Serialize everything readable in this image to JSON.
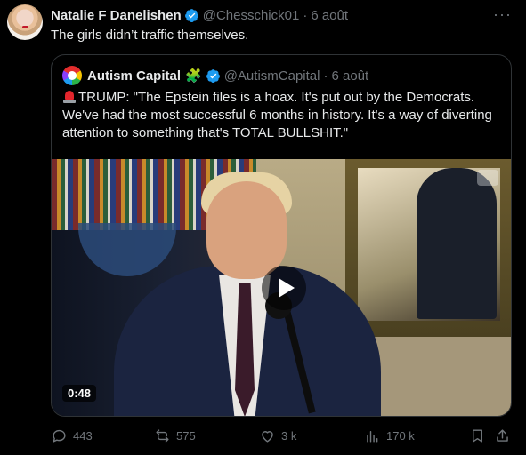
{
  "post": {
    "author_name": "Natalie F Danelishen",
    "handle": "@Chesschick01",
    "separator": "·",
    "time": "6 août",
    "text": "The girls didn’t traffic themselves.",
    "more_icon": "more-dots-icon"
  },
  "quote": {
    "author_name": "Autism Capital",
    "emoji": "🧩",
    "handle": "@AutismCapital",
    "separator": "·",
    "time": "6 août",
    "text": "TRUMP: \"The Epstein files is a hoax. It's put out by the Democrats. We've had the most successful 6 months in history. It's a way of diverting attention to something that's TOTAL BULLSHIT.\"",
    "video": {
      "duration": "0:48"
    }
  },
  "actions": {
    "replies": "443",
    "reposts": "575",
    "likes": "3 k",
    "views": "170 k"
  },
  "colors": {
    "background": "#000000",
    "text": "#e7e9ea",
    "muted": "#71767b",
    "verified": "#1d9bf0",
    "border": "#2f3336"
  }
}
